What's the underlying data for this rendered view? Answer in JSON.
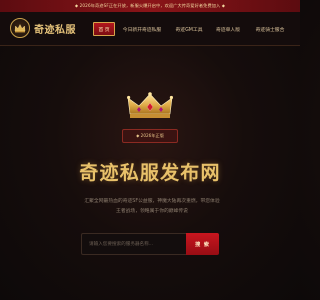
{
  "announcement": "◆ 2026年奇迹SF正在开放，新服火爆开启中，欢迎广大传奇爱好者免费加入 ◆",
  "logo": {
    "text": "奇迹私服",
    "icon": "crown-medallion-icon"
  },
  "nav": {
    "items": [
      {
        "label": "首 页",
        "active": true
      },
      {
        "label": "今日新开奇迹私服",
        "active": false
      },
      {
        "label": "奇迹GM工具",
        "active": false
      },
      {
        "label": "奇迹单人版",
        "active": false
      },
      {
        "label": "奇迹骑士服合",
        "active": false
      }
    ]
  },
  "hero": {
    "crown_icon": "gold-crown-icon",
    "badge": "◆ 2026年正版",
    "title": "奇迹私服发布网",
    "description": "汇聚全网最热血的奇迹SF公益服，神魔大陆再次重燃，带您体验王者战场，领略属于你的巅峰传说",
    "search_placeholder": "请输入您要搜索的服务器名称...",
    "search_button": "搜 索"
  },
  "colors": {
    "accent_red": "#b3161d",
    "gold": "#e8c16a",
    "background": "#160d0c"
  }
}
